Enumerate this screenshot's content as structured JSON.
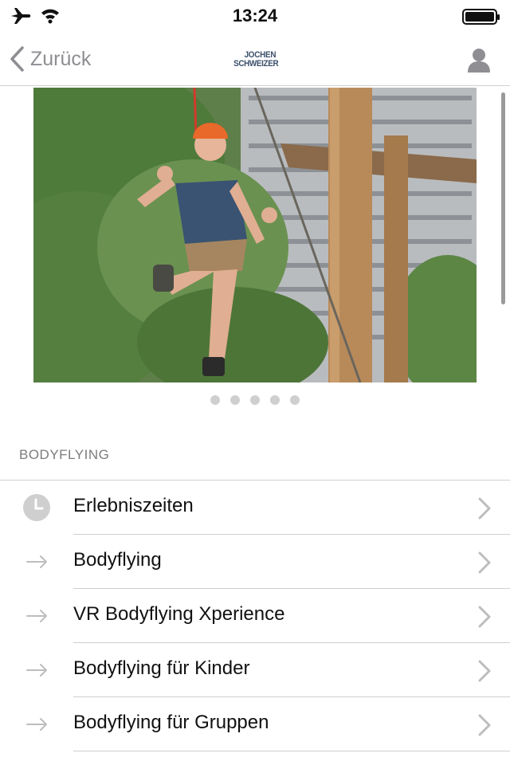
{
  "status_bar": {
    "time": "13:24",
    "icons": [
      "airplane-icon",
      "wifi-icon",
      "battery-icon"
    ]
  },
  "nav": {
    "back_label": "Zurück",
    "logo_line1": "JOCHEN",
    "logo_line2": "SCHWEIZER",
    "profile_icon": "person-icon"
  },
  "carousel": {
    "image": "photo of smiling man in climbing harness on a high ropes course",
    "page_count": 5
  },
  "section": {
    "title": "BODYFLYING"
  },
  "list": [
    {
      "label": "Erlebniszeiten",
      "icon": "clock-icon"
    },
    {
      "label": "Bodyflying",
      "icon": "arrow-right-icon"
    },
    {
      "label": "VR Bodyflying Xperience",
      "icon": "arrow-right-icon"
    },
    {
      "label": "Bodyflying für Kinder",
      "icon": "arrow-right-icon"
    },
    {
      "label": "Bodyflying für Gruppen",
      "icon": "arrow-right-icon"
    }
  ],
  "colors": {
    "accent_gray": "#8e8e93",
    "separator": "#cfcfcf",
    "brand_blue": "#3b4f6b"
  }
}
